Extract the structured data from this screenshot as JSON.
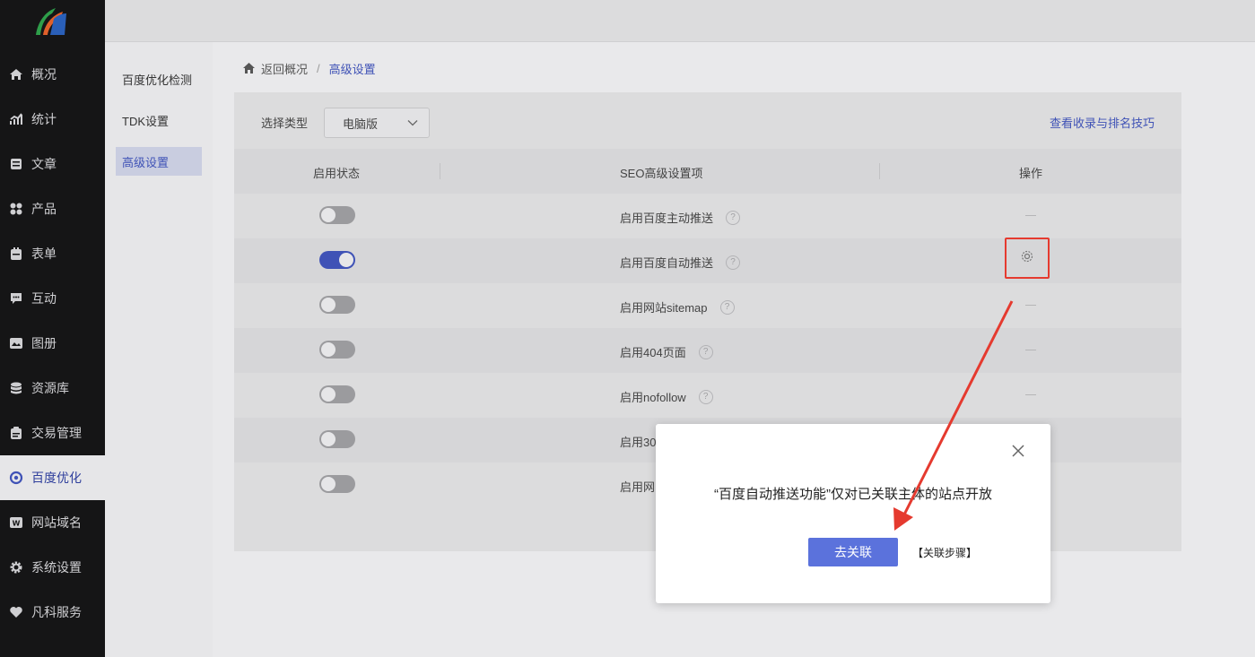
{
  "sidebar": {
    "items": [
      {
        "label": "概况",
        "icon": "home-icon"
      },
      {
        "label": "统计",
        "icon": "stats-icon"
      },
      {
        "label": "文章",
        "icon": "article-icon"
      },
      {
        "label": "产品",
        "icon": "product-icon"
      },
      {
        "label": "表单",
        "icon": "form-icon"
      },
      {
        "label": "互动",
        "icon": "chat-icon"
      },
      {
        "label": "图册",
        "icon": "album-icon"
      },
      {
        "label": "资源库",
        "icon": "database-icon"
      },
      {
        "label": "交易管理",
        "icon": "trade-icon"
      },
      {
        "label": "百度优化",
        "icon": "baidu-seo-icon"
      },
      {
        "label": "网站域名",
        "icon": "domain-icon"
      },
      {
        "label": "系统设置",
        "icon": "gear-icon"
      },
      {
        "label": "凡科服务",
        "icon": "heart-icon"
      }
    ],
    "active_index": 9
  },
  "submenu": {
    "items": [
      {
        "label": "百度优化检测"
      },
      {
        "label": "TDK设置"
      },
      {
        "label": "高级设置"
      }
    ],
    "active_index": 2
  },
  "breadcrumb": {
    "back": "返回概况",
    "separator": "/",
    "current": "高级设置"
  },
  "filters": {
    "type_label": "选择类型",
    "type_value": "电脑版",
    "tips_link": "查看收录与排名技巧"
  },
  "table": {
    "headers": [
      "启用状态",
      "SEO高级设置项",
      "操作"
    ],
    "rows": [
      {
        "enabled": false,
        "label": "启用百度主动推送",
        "action": "—"
      },
      {
        "enabled": true,
        "label": "启用百度自动推送",
        "action": "gear"
      },
      {
        "enabled": false,
        "label": "启用网站sitemap",
        "action": "—"
      },
      {
        "enabled": false,
        "label": "启用404页面",
        "action": "—"
      },
      {
        "enabled": false,
        "label": "启用nofollow",
        "action": "—"
      },
      {
        "enabled": false,
        "label": "启用30",
        "action": ""
      },
      {
        "enabled": false,
        "label": "启用网",
        "action": ""
      }
    ]
  },
  "dialog": {
    "message": "“百度自动推送功能”仅对已关联主体的站点开放",
    "primary_button": "去关联",
    "steps_link": "【关联步骤】"
  },
  "colors": {
    "accent": "#3f52b6",
    "button": "#5b72dc",
    "highlight": "#e53a2f"
  }
}
